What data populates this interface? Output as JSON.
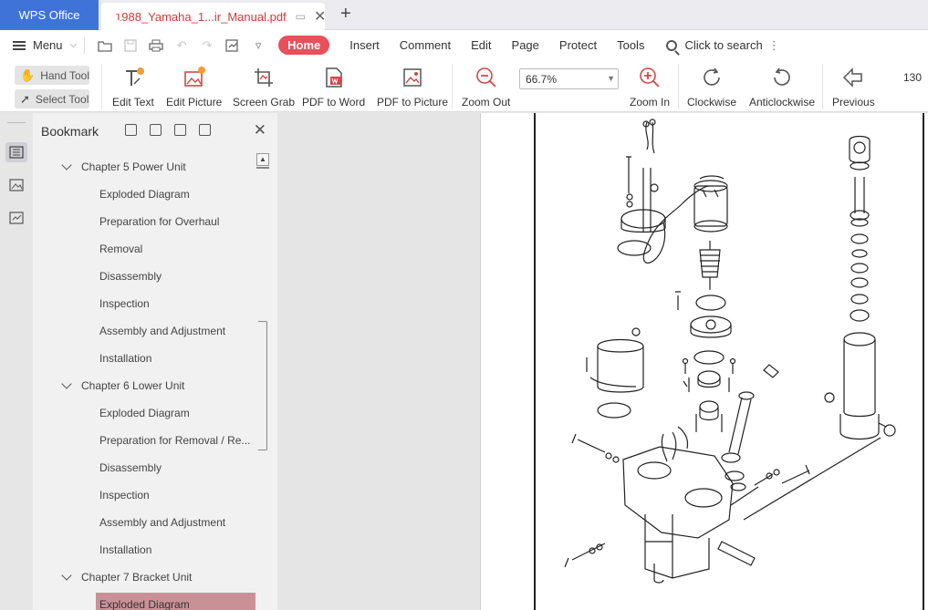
{
  "tabbar": {
    "app_name": "WPS Office",
    "doc_tab_name": "1988_Yamaha_1...ir_Manual.pdf",
    "new_tab_symbol": "+"
  },
  "menubar": {
    "menu_label": "Menu",
    "home_label": "Home",
    "tabs": [
      "Insert",
      "Comment",
      "Edit",
      "Page",
      "Protect",
      "Tools"
    ],
    "search_label": "Click to search"
  },
  "toolbar": {
    "hand_tool": "Hand Tool",
    "select_tool": "Select Tool",
    "edit_text": "Edit Text",
    "edit_picture": "Edit Picture",
    "screen_grab": "Screen Grab",
    "pdf_to_word": "PDF to Word",
    "pdf_to_picture": "PDF to Picture",
    "zoom_out": "Zoom Out",
    "zoom_value": "66.7%",
    "zoom_in": "Zoom In",
    "clockwise": "Clockwise",
    "anticlockwise": "Anticlockwise",
    "previous": "Previous",
    "page_number": "130"
  },
  "bookmark": {
    "title": "Bookmark",
    "items": [
      {
        "label": "Chapter 5 Power Unit",
        "level": "chapter"
      },
      {
        "label": "Exploded Diagram",
        "level": "sub"
      },
      {
        "label": "Preparation for Overhaul",
        "level": "sub"
      },
      {
        "label": "Removal",
        "level": "sub"
      },
      {
        "label": "Disassembly",
        "level": "sub"
      },
      {
        "label": "Inspection",
        "level": "sub"
      },
      {
        "label": "Assembly and Adjustment",
        "level": "sub"
      },
      {
        "label": "Installation",
        "level": "sub"
      },
      {
        "label": "Chapter 6 Lower Unit",
        "level": "chapter"
      },
      {
        "label": "Exploded Diagram",
        "level": "sub"
      },
      {
        "label": "Preparation for Removal / Re...",
        "level": "sub"
      },
      {
        "label": "Disassembly",
        "level": "sub"
      },
      {
        "label": "Inspection",
        "level": "sub"
      },
      {
        "label": "Assembly and Adjustment",
        "level": "sub"
      },
      {
        "label": "Installation",
        "level": "sub"
      },
      {
        "label": "Chapter 7 Bracket Unit",
        "level": "chapter"
      },
      {
        "label": "Exploded Diagram",
        "level": "sub",
        "selected": true
      }
    ]
  },
  "colors": {
    "app_tab": "#3f73d8",
    "home_pill": "#e8505b",
    "selected_bookmark": "#c99197",
    "doc_tab_text": "#d03a3a"
  }
}
